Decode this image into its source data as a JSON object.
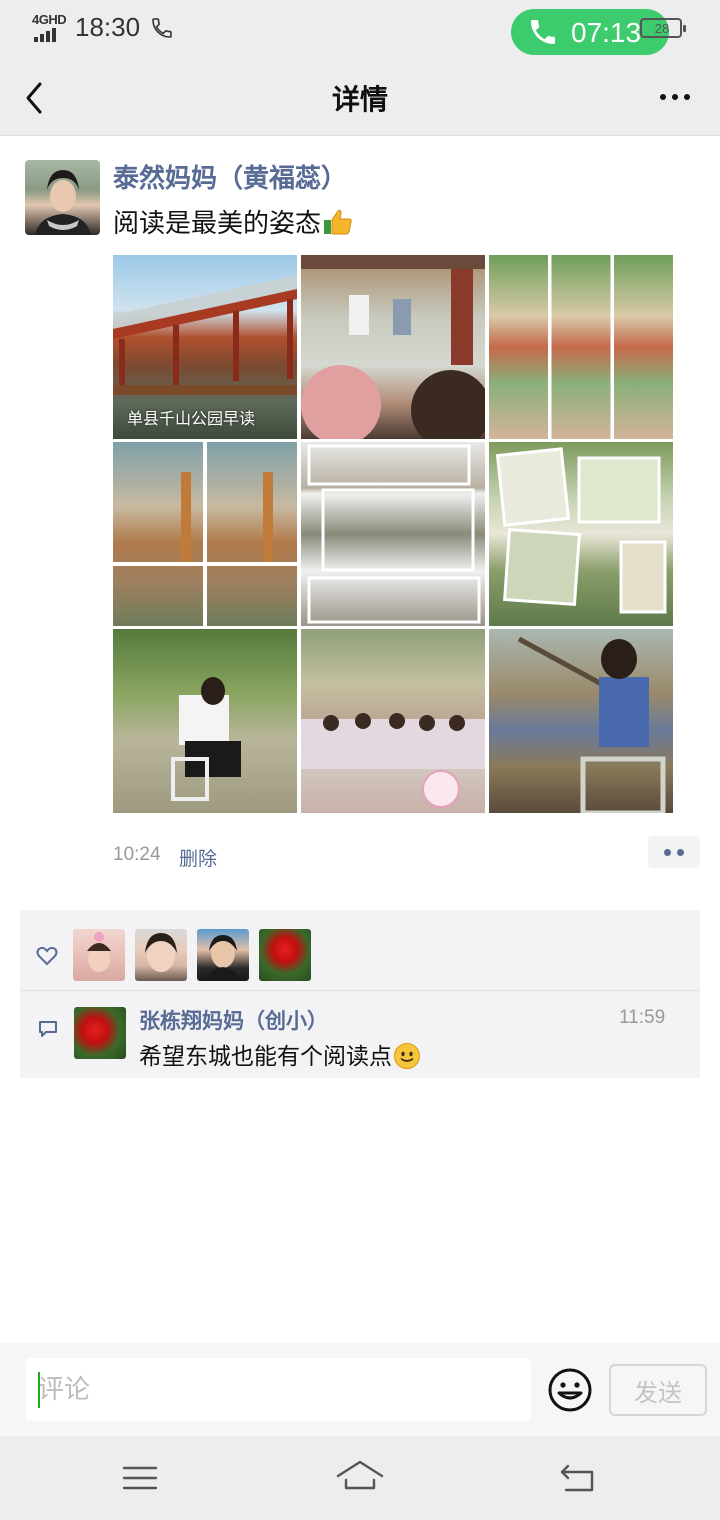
{
  "status_bar": {
    "network": "4GHD",
    "time": "18:30",
    "call_timer": "07:13",
    "battery": "28"
  },
  "nav": {
    "title": "详情"
  },
  "post": {
    "author": "泰然妈妈（黄福蕊）",
    "text": "阅读是最美的姿态",
    "photos": [
      {
        "caption": "单县千山公园早读"
      },
      {
        "caption": ""
      },
      {
        "caption": ""
      },
      {
        "caption": ""
      },
      {
        "caption": ""
      },
      {
        "caption": ""
      },
      {
        "caption": ""
      },
      {
        "caption": ""
      },
      {
        "caption": ""
      }
    ],
    "time": "10:24",
    "delete_label": "删除"
  },
  "likes": {
    "count": 4
  },
  "comments": [
    {
      "author": "张栋翔妈妈（创小）",
      "time": "11:59",
      "text": "希望东城也能有个阅读点"
    }
  ],
  "input": {
    "placeholder": "评论",
    "send_label": "发送"
  },
  "colors": {
    "link": "#576b95",
    "call_green": "#3dcc6d",
    "background": "#ffffff",
    "bar_gray": "#ededed"
  }
}
